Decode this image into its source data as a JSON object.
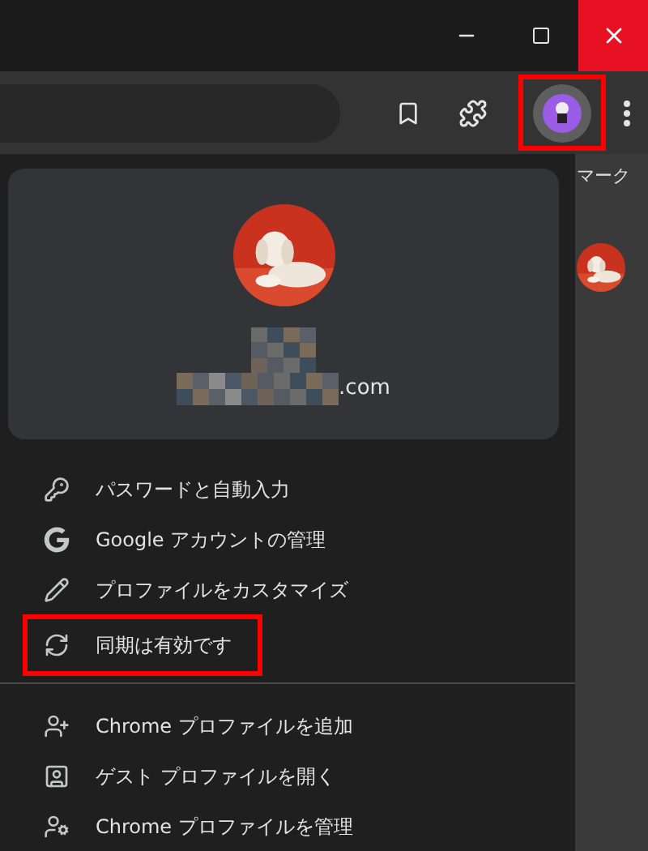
{
  "toolbar": {
    "avatar_highlighted": true
  },
  "page_behind": {
    "text": "マーク"
  },
  "profile_card": {
    "email_suffix": ".com"
  },
  "menu_sections": [
    {
      "items": [
        {
          "kind": "key",
          "label": "パスワードと自動入力",
          "highlighted": false
        },
        {
          "kind": "google",
          "label": "Google アカウントの管理",
          "highlighted": false
        },
        {
          "kind": "pencil",
          "label": "プロファイルをカスタマイズ",
          "highlighted": false
        },
        {
          "kind": "sync",
          "label": "同期は有効です",
          "highlighted": true
        }
      ]
    },
    {
      "items": [
        {
          "kind": "add-person",
          "label": "Chrome プロファイルを追加",
          "highlighted": false
        },
        {
          "kind": "guest",
          "label": "ゲスト プロファイルを開く",
          "highlighted": false
        },
        {
          "kind": "manage",
          "label": "Chrome プロファイルを管理",
          "highlighted": false
        }
      ]
    }
  ]
}
